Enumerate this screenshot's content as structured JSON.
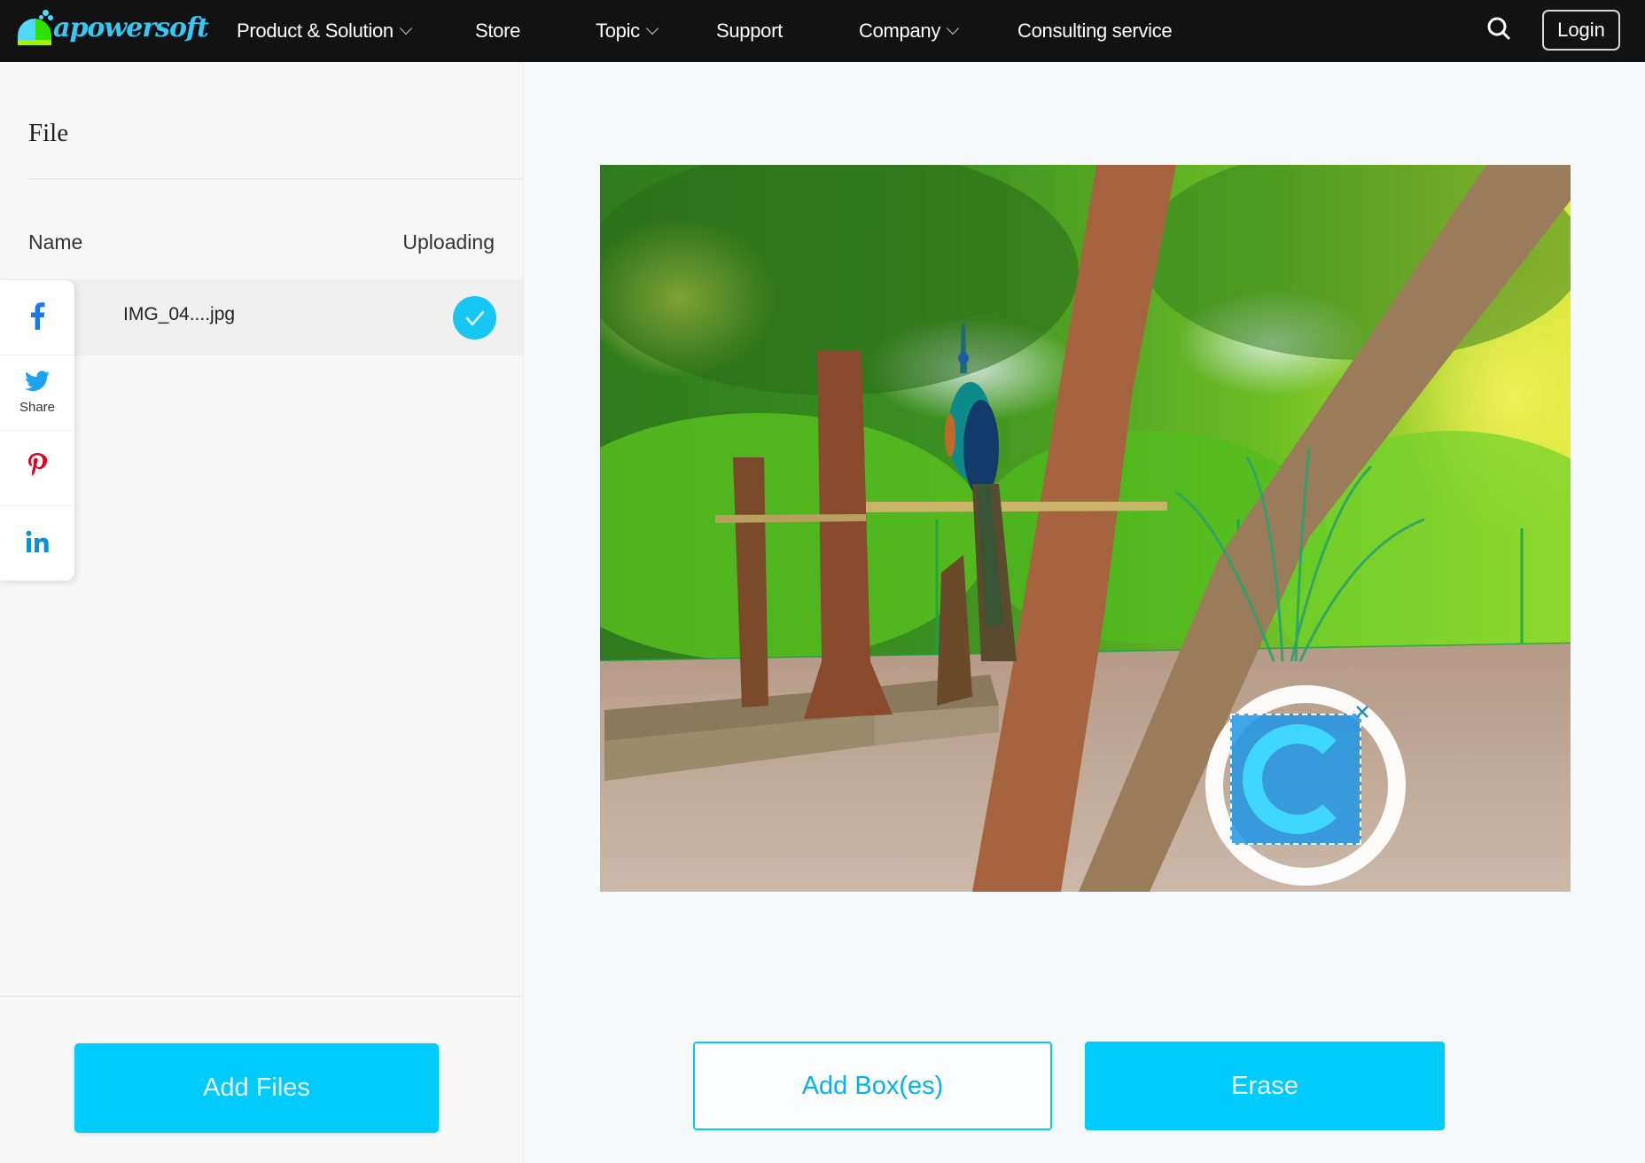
{
  "nav": {
    "logo_text": "apowersoft",
    "items": [
      {
        "label": "Product & Solution",
        "has_dropdown": true
      },
      {
        "label": "Store",
        "has_dropdown": false
      },
      {
        "label": "Topic",
        "has_dropdown": true
      },
      {
        "label": "Support",
        "has_dropdown": false
      },
      {
        "label": "Company",
        "has_dropdown": true
      },
      {
        "label": "Consulting service",
        "has_dropdown": false
      }
    ],
    "search_icon": "search-icon",
    "login_label": "Login"
  },
  "file_panel": {
    "title": "File",
    "columns": {
      "name": "Name",
      "status": "Uploading"
    },
    "files": [
      {
        "name": "IMG_04....jpg",
        "status": "uploaded",
        "status_icon": "check-circle-icon"
      }
    ],
    "add_files_label": "Add Files"
  },
  "share_bar": {
    "items": [
      {
        "network": "facebook",
        "icon": "facebook-icon",
        "label": ""
      },
      {
        "network": "twitter",
        "icon": "twitter-icon",
        "label": "Share"
      },
      {
        "network": "pinterest",
        "icon": "pinterest-icon",
        "label": ""
      },
      {
        "network": "linkedin",
        "icon": "linkedin-icon",
        "label": ""
      }
    ]
  },
  "editor": {
    "image_description": "Peacock perched on a branch among trees in a park enclosure",
    "watermark": "circled C logo",
    "selection_boxes": 1,
    "add_box_label": "Add Box(es)",
    "erase_label": "Erase"
  },
  "colors": {
    "accent": "#00cbff",
    "nav_bg": "#121212",
    "check": "#16c6f3",
    "facebook": "#1877f2",
    "twitter": "#1da1f2",
    "pinterest": "#e60023",
    "linkedin": "#0a8fdb"
  }
}
